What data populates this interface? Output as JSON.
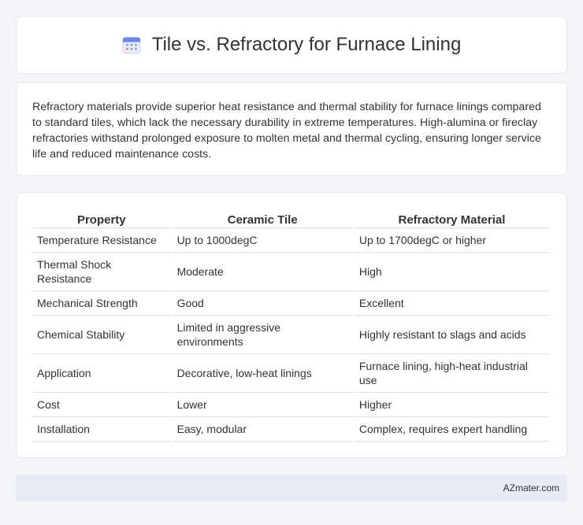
{
  "header": {
    "title": "Tile vs. Refractory for Furnace Lining",
    "icon": "calendar-icon",
    "icon_color": "#6b82e0"
  },
  "intro": {
    "text": "Refractory materials provide superior heat resistance and thermal stability for furnace linings compared to standard tiles, which lack the necessary durability in extreme temperatures. High-alumina or fireclay refractories withstand prolonged exposure to molten metal and thermal cycling, ensuring longer service life and reduced maintenance costs."
  },
  "table": {
    "headers": [
      "Property",
      "Ceramic Tile",
      "Refractory Material"
    ],
    "rows": [
      [
        "Temperature Resistance",
        "Up to 1000degC",
        "Up to 1700degC or higher"
      ],
      [
        "Thermal Shock Resistance",
        "Moderate",
        "High"
      ],
      [
        "Mechanical Strength",
        "Good",
        "Excellent"
      ],
      [
        "Chemical Stability",
        "Limited in aggressive environments",
        "Highly resistant to slags and acids"
      ],
      [
        "Application",
        "Decorative, low-heat linings",
        "Furnace lining, high-heat industrial use"
      ],
      [
        "Cost",
        "Lower",
        "Higher"
      ],
      [
        "Installation",
        "Easy, modular",
        "Complex, requires expert handling"
      ]
    ]
  },
  "footer": {
    "text": "AZmater.com"
  }
}
